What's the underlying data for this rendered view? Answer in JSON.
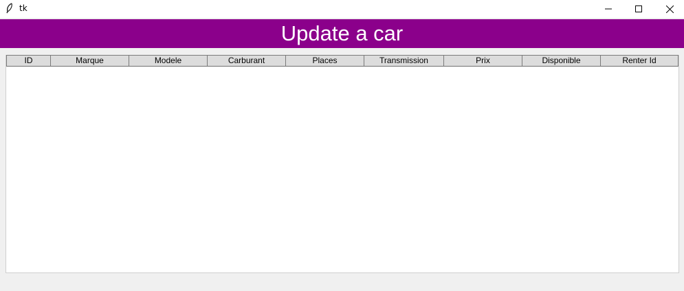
{
  "window": {
    "title": "tk",
    "icon": "feather-icon",
    "controls": [
      "minimize-icon",
      "maximize-icon",
      "close-icon"
    ]
  },
  "header": {
    "title": "Update a car",
    "background": "#8b008b",
    "text_color": "#ffffff"
  },
  "table": {
    "columns": [
      "ID",
      "Marque",
      "Modele",
      "Carburant",
      "Places",
      "Transmission",
      "Prix",
      "Disponible",
      "Renter Id"
    ],
    "rows": []
  }
}
